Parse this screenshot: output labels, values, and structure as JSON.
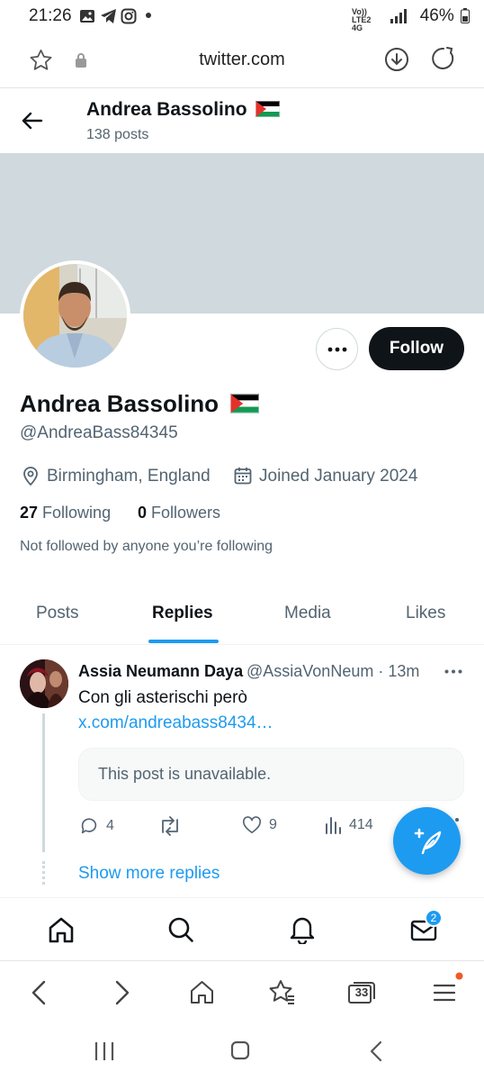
{
  "status_bar": {
    "time": "21:26",
    "network": "Vo)) LTE2 4G",
    "battery": "46%"
  },
  "browser": {
    "url": "twitter.com",
    "tabs_count": "33"
  },
  "header": {
    "name": "Andrea Bassolino",
    "posts_count": "138 posts"
  },
  "profile": {
    "display_name": "Andrea Bassolino",
    "handle": "@AndreaBass84345",
    "location": "Birmingham, England",
    "joined": "Joined January 2024",
    "following_count": "27",
    "following_label": "Following",
    "followers_count": "0",
    "followers_label": "Followers",
    "not_followed_note": "Not followed by anyone you’re following",
    "follow_label": "Follow",
    "flag_icon": "palestine-flag-icon"
  },
  "tabs": [
    {
      "label": "Posts",
      "active": false
    },
    {
      "label": "Replies",
      "active": true
    },
    {
      "label": "Media",
      "active": false
    },
    {
      "label": "Likes",
      "active": false
    }
  ],
  "tweet": {
    "author": "Assia Neumann Dayan",
    "handle_time": "@AssiaVonNeum · 13m",
    "text": "Con gli asterischi però",
    "link": "x.com/andreabass8434…",
    "quote": "This post is unavailable.",
    "replies": "4",
    "retweets": "",
    "likes": "9",
    "views": "414"
  },
  "show_more": "Show more replies",
  "bottom_nav": {
    "messages_badge": "2"
  },
  "colors": {
    "accent": "#1d9bf0",
    "text": "#0f1419",
    "secondary": "#536471",
    "banner": "#cfd9de"
  }
}
